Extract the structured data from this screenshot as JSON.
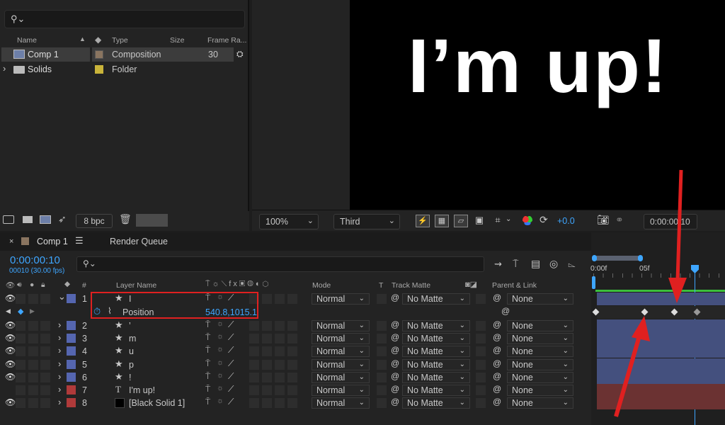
{
  "project": {
    "columns": {
      "name": "Name",
      "type": "Type",
      "size": "Size",
      "frame_rate": "Frame Ra..."
    },
    "items": [
      {
        "name": "Comp 1",
        "type": "Composition",
        "frame_rate": "30",
        "swatch": "#8a7560"
      },
      {
        "name": "Solids",
        "type": "Folder",
        "frame_rate": "",
        "swatch": "#c9b43a"
      }
    ],
    "bpc": "8 bpc"
  },
  "viewer": {
    "canvas_text": "I’m up!",
    "zoom": "100%",
    "view": "Third",
    "exposure": "+0.0",
    "timecode": "0:00:00:10"
  },
  "timeline": {
    "tab_comp": "Comp 1",
    "tab_render": "Render Queue",
    "current_time": "0:00:00:10",
    "frame_info": "00010 (30.00 fps)",
    "ruler": {
      "start": "0:00f",
      "mark": "05f"
    },
    "columns": {
      "hash": "#",
      "layer_name": "Layer Name",
      "mode": "Mode",
      "t": "T",
      "track_matte": "Track Matte",
      "parent": "Parent & Link"
    },
    "layers": [
      {
        "num": "1",
        "name": "I",
        "label": "#5566b0",
        "mode": "Normal",
        "matte": "No Matte",
        "parent": "None",
        "type": "star"
      },
      {
        "num": "2",
        "name": "’",
        "label": "#5566b0",
        "mode": "Normal",
        "matte": "No Matte",
        "parent": "None",
        "type": "star"
      },
      {
        "num": "3",
        "name": "m",
        "label": "#5566b0",
        "mode": "Normal",
        "matte": "No Matte",
        "parent": "None",
        "type": "star"
      },
      {
        "num": "4",
        "name": "u",
        "label": "#5566b0",
        "mode": "Normal",
        "matte": "No Matte",
        "parent": "None",
        "type": "star"
      },
      {
        "num": "5",
        "name": "p",
        "label": "#5566b0",
        "mode": "Normal",
        "matte": "No Matte",
        "parent": "None",
        "type": "star"
      },
      {
        "num": "6",
        "name": "!",
        "label": "#5566b0",
        "mode": "Normal",
        "matte": "No Matte",
        "parent": "None",
        "type": "star"
      },
      {
        "num": "7",
        "name": "I'm up!",
        "label": "#b03a3a",
        "mode": "Normal",
        "matte": "No Matte",
        "parent": "None",
        "type": "text"
      },
      {
        "num": "8",
        "name": "[Black Solid 1]",
        "label": "#b03a3a",
        "mode": "Normal",
        "matte": "No Matte",
        "parent": "None",
        "type": "solid"
      }
    ],
    "property": {
      "name": "Position",
      "value": "540.8,1015.1"
    }
  },
  "colors": {
    "accent_blue": "#3ea6ff",
    "highlight_red": "#e02020",
    "layer_bar_blue": "#44507e",
    "layer_bar_red": "#6b3232"
  }
}
